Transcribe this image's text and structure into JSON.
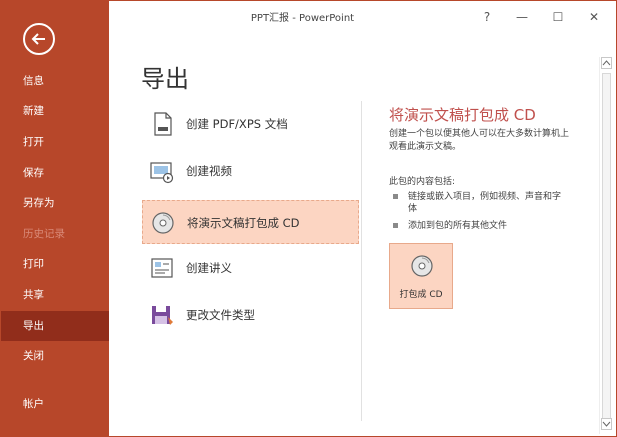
{
  "window": {
    "title": "PPT汇报 - PowerPoint",
    "help": "?",
    "minimize": "—",
    "maximize": "☐",
    "close": "✕"
  },
  "sidebar": {
    "items": [
      {
        "label": "信息"
      },
      {
        "label": "新建"
      },
      {
        "label": "打开"
      },
      {
        "label": "保存"
      },
      {
        "label": "另存为"
      },
      {
        "label": "历史记录"
      },
      {
        "label": "打印"
      },
      {
        "label": "共享"
      },
      {
        "label": "导出"
      },
      {
        "label": "关闭"
      },
      {
        "label": "帐户"
      }
    ]
  },
  "main": {
    "page_title": "导出",
    "export_options": [
      {
        "label": "创建 PDF/XPS 文档",
        "icon": "pdf-document-icon"
      },
      {
        "label": "创建视频",
        "icon": "video-icon"
      },
      {
        "label": "将演示文稿打包成 CD",
        "icon": "cd-icon",
        "selected": true
      },
      {
        "label": "创建讲义",
        "icon": "handout-icon"
      },
      {
        "label": "更改文件类型",
        "icon": "file-type-icon"
      }
    ],
    "detail": {
      "title": "将演示文稿打包成 CD",
      "description": "创建一个包以便其他人可以在大多数计算机上观看此演示文稿。",
      "contains_label": "此包的内容包括:",
      "bullets": [
        "链接或嵌入项目，例如视频、声音和字体",
        "添加到包的所有其他文件"
      ],
      "button_label": "打包成 CD"
    }
  },
  "colors": {
    "accent": "#b7472a",
    "accent_dark": "#912d1b",
    "selected_bg": "#fcd5c2",
    "detail_title": "#c0504d"
  }
}
